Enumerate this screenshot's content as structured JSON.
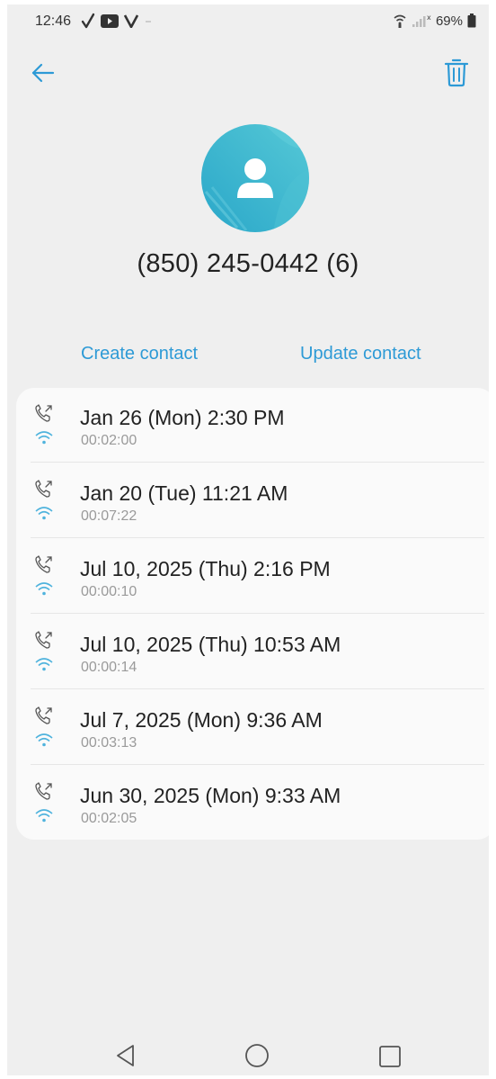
{
  "status_bar": {
    "time": "12:46",
    "battery": "69%",
    "icons": [
      "check-icon",
      "youtube-icon",
      "verizon-icon",
      "wifi-call-icon",
      "signal-icon",
      "battery-icon"
    ]
  },
  "header": {
    "back_icon": "arrow-left-icon",
    "delete_icon": "trash-icon"
  },
  "contact": {
    "avatar_icon": "person-icon",
    "title": "(850) 245-0442 (6)"
  },
  "actions": {
    "create": "Create contact",
    "update": "Update contact"
  },
  "calls": [
    {
      "date": "Jan 26 (Mon) 2:30 PM",
      "duration": "00:02:00"
    },
    {
      "date": "Jan 20 (Tue) 11:21 AM",
      "duration": "00:07:22"
    },
    {
      "date": "Jul 10, 2025 (Thu) 2:16 PM",
      "duration": "00:00:10"
    },
    {
      "date": "Jul 10, 2025 (Thu) 10:53 AM",
      "duration": "00:00:14"
    },
    {
      "date": "Jul 7, 2025 (Mon) 9:36 AM",
      "duration": "00:03:13"
    },
    {
      "date": "Jun 30, 2025 (Mon) 9:33 AM",
      "duration": "00:02:05"
    }
  ],
  "colors": {
    "accent": "#2d9ad6",
    "avatar": "#3cb3cc",
    "background": "#efefef"
  }
}
